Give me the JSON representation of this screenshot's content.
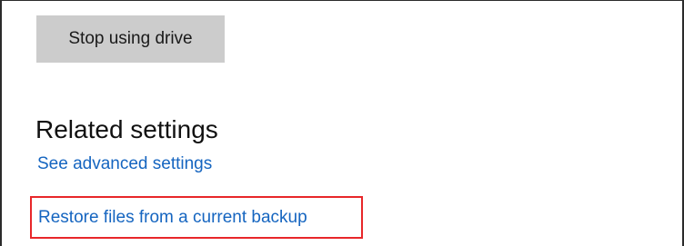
{
  "buttons": {
    "stop_using_drive": "Stop using drive"
  },
  "related_settings": {
    "heading": "Related settings",
    "links": {
      "advanced": "See advanced settings",
      "restore": "Restore files from a current backup"
    }
  },
  "colors": {
    "link": "#1565c0",
    "button_bg": "#cccccc",
    "highlight_border": "#e8272a"
  }
}
